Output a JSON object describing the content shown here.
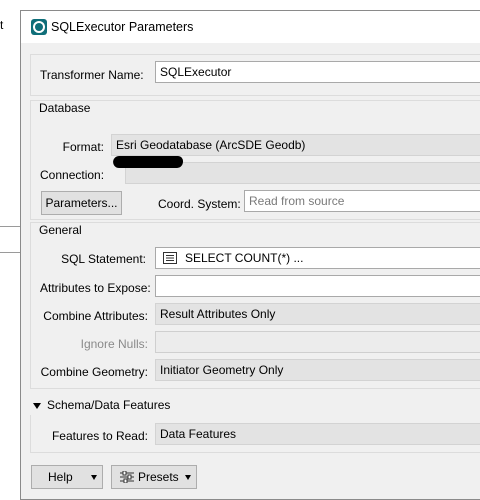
{
  "background": {
    "fragment_text": "t"
  },
  "window": {
    "title": "SQLExecutor Parameters"
  },
  "transformer": {
    "name_label": "Transformer Name:",
    "name_value": "SQLExecutor"
  },
  "database": {
    "section_label": "Database",
    "format_label": "Format:",
    "format_value": "Esri Geodatabase (ArcSDE Geodb)",
    "connection_label": "Connection:",
    "parameters_button": "Parameters...",
    "coord_label": "Coord. System:",
    "coord_placeholder": "Read from source"
  },
  "general": {
    "section_label": "General",
    "sql_label": "SQL Statement:",
    "sql_value": "SELECT COUNT(*) ...",
    "attributes_label": "Attributes to Expose:",
    "attributes_value": "",
    "combine_attr_label": "Combine Attributes:",
    "combine_attr_value": "Result Attributes Only",
    "ignore_nulls_label": "Ignore Nulls:",
    "ignore_nulls_value": "",
    "combine_geom_label": "Combine Geometry:",
    "combine_geom_value": "Initiator Geometry Only"
  },
  "schema": {
    "section_label": "Schema/Data Features",
    "features_label": "Features to Read:",
    "features_value": "Data Features"
  },
  "footer": {
    "help_button": "Help",
    "presets_button": "Presets"
  },
  "icons": [
    "app-icon",
    "collapse-triangle-icon",
    "sql-editor-icon",
    "dropdown-arrow-icon",
    "presets-icon"
  ]
}
